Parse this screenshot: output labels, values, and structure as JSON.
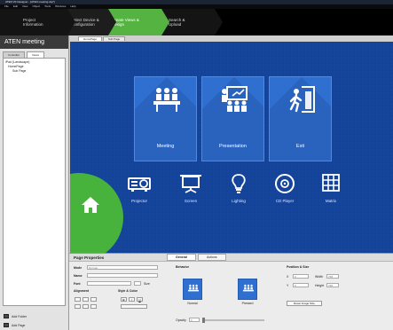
{
  "window": {
    "title": "ATEN VK Designer - [ATEN meeting.vkp*]"
  },
  "menu": [
    "File",
    "Edit",
    "View",
    "Object",
    "Tools",
    "Windows",
    "Help"
  ],
  "steps": [
    {
      "label": "Project\nInformation"
    },
    {
      "label": "Select Device &\nConfiguration"
    },
    {
      "label": "Create Views &\nDesign"
    },
    {
      "label": "Search &\nUpload"
    }
  ],
  "left_panel": {
    "project_title": "ATEN meeting",
    "tabs": [
      "Controller",
      "Views"
    ],
    "tree": [
      {
        "label": "iPad (Landscape)",
        "level": 0
      },
      {
        "label": "HomePage",
        "level": 1
      },
      {
        "label": "Sub Page",
        "level": 2
      }
    ],
    "buttons": {
      "add_folder": "Add Folder",
      "add_page": "Add Page"
    }
  },
  "page_tabs": [
    "HomePage",
    "Sub Page"
  ],
  "canvas": {
    "tiles": [
      {
        "label": "Meeting",
        "icon": "meeting-icon"
      },
      {
        "label": "Presentation",
        "icon": "presentation-icon"
      },
      {
        "label": "Exit",
        "icon": "exit-icon"
      }
    ],
    "devices": [
      {
        "label": "Projector",
        "icon": "projector-icon"
      },
      {
        "label": "Screen",
        "icon": "screen-icon"
      },
      {
        "label": "Lighting",
        "icon": "lightbulb-icon"
      },
      {
        "label": "CD Player",
        "icon": "disc-icon"
      },
      {
        "label": "Matrix",
        "icon": "grid-icon"
      }
    ],
    "home_icon": "home-icon",
    "colors": {
      "background": "#14439a",
      "tile": "#2f6fd0",
      "home": "#48b33c",
      "active_step": "#55b441"
    }
  },
  "properties": {
    "title": "Page Properties",
    "tabs": [
      "General",
      "Actions"
    ],
    "fields": {
      "mode_label": "Mode",
      "mode_value": "Normal",
      "name_label": "Name",
      "name_value": "",
      "font_label": "Font",
      "size_label": "Size",
      "alignment_label": "Alignment",
      "style_color_label": "Style & Color",
      "style_bold": "B",
      "style_italic": "I",
      "style_underline": "U"
    },
    "behavior": {
      "title": "Behavior",
      "normal_label": "Normal",
      "pressed_label": "Pressed",
      "opacity_label": "Opacity",
      "opacity_value": "0"
    },
    "position_size": {
      "title": "Position & Size",
      "x_label": "X",
      "x_value": "0",
      "y_label": "Y",
      "y_value": "0",
      "width_label": "Width",
      "width_value": "768",
      "height_label": "Height",
      "height_value": "768",
      "reset_button": "Reset Image Size"
    }
  }
}
